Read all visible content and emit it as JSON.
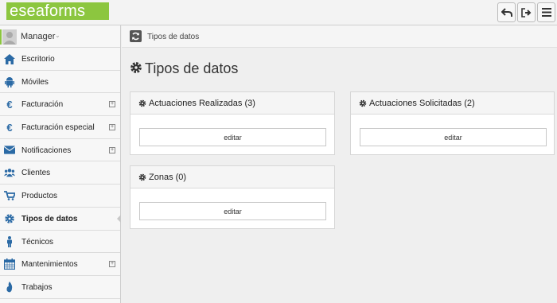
{
  "app": {
    "logo_text": "eseaforms",
    "brand_color": "#8cc63f"
  },
  "topbar": {
    "buttons": [
      {
        "icon": "undo-icon"
      },
      {
        "icon": "sign-out-icon"
      },
      {
        "icon": "menu-icon"
      }
    ]
  },
  "user": {
    "name": "Manager",
    "caret": "⌄"
  },
  "sidebar": {
    "items": [
      {
        "label": "Escritorio",
        "icon": "home-icon",
        "expandable": false
      },
      {
        "label": "Móviles",
        "icon": "android-icon",
        "expandable": false
      },
      {
        "label": "Facturación",
        "icon": "euro-icon",
        "expandable": true
      },
      {
        "label": "Facturación especial",
        "icon": "euro-icon",
        "expandable": true
      },
      {
        "label": "Notificaciones",
        "icon": "envelope-icon",
        "expandable": true
      },
      {
        "label": "Clientes",
        "icon": "users-icon",
        "expandable": false
      },
      {
        "label": "Productos",
        "icon": "cart-icon",
        "expandable": false
      },
      {
        "label": "Tipos de datos",
        "icon": "gear-icon",
        "expandable": false,
        "active": true
      },
      {
        "label": "Técnicos",
        "icon": "male-icon",
        "expandable": false
      },
      {
        "label": "Mantenimientos",
        "icon": "calendar-icon",
        "expandable": true
      },
      {
        "label": "Trabajos",
        "icon": "fire-icon",
        "expandable": false
      }
    ],
    "expand_symbol": "+"
  },
  "breadcrumb": {
    "text": "Tipos de datos",
    "icon": "refresh-icon"
  },
  "main": {
    "title": "Tipos de datos",
    "panels": [
      {
        "title": "Actuaciones Realizadas (3)",
        "button": "editar"
      },
      {
        "title": "Actuaciones Solicitadas (2)",
        "button": "editar"
      },
      {
        "title": "Zonas (0)",
        "button": "editar"
      }
    ]
  }
}
